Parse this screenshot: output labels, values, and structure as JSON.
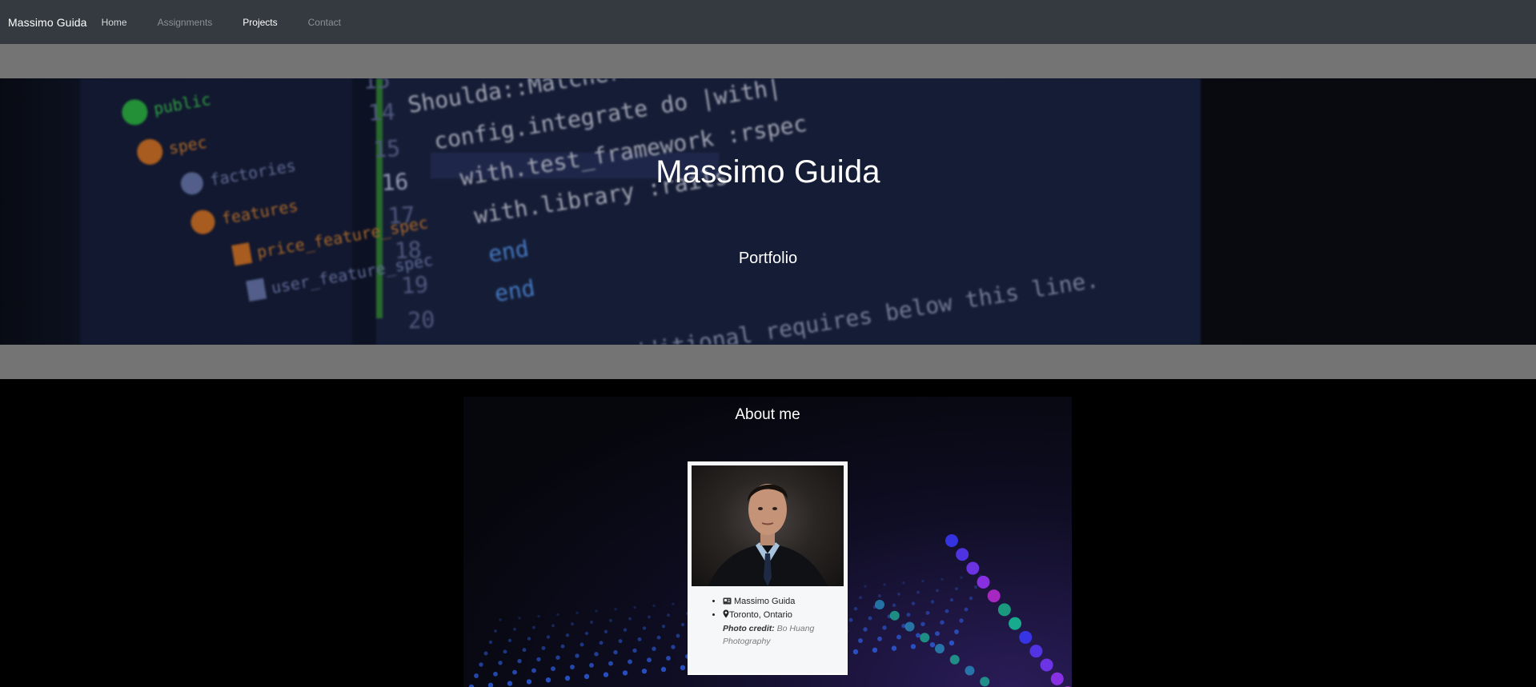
{
  "navbar": {
    "brand": "Massimo Guida",
    "links": [
      {
        "label": "Home"
      },
      {
        "label": "Assignments"
      },
      {
        "label": "Projects"
      },
      {
        "label": "Contact"
      }
    ]
  },
  "hero": {
    "title": "Massimo Guida",
    "subtitle": "Portfolio",
    "code_lines": [
      {
        "num": "15",
        "text": "Shoulda::Matchers.configure do |config|"
      },
      {
        "num": "14",
        "text": "  config.integrate do |with|"
      },
      {
        "num": "15",
        "text": "    with.test_framework :rspec"
      },
      {
        "num": "16",
        "text": "    with.library :rails"
      },
      {
        "num": "17",
        "text": "  end"
      },
      {
        "num": "18",
        "text": "end"
      },
      {
        "num": "19",
        "text": ""
      },
      {
        "num": "20",
        "text": "# Add additional requires below this line."
      }
    ],
    "file_tree": [
      "public",
      "spec",
      "factories",
      "features",
      "price_feature_spec",
      "user_feature_spec"
    ]
  },
  "about": {
    "title": "About me",
    "name": "Massimo Guida",
    "location": "Toronto, Ontario",
    "photo_credit_label": "Photo credit:",
    "photo_credit_value": "Bo Huang Photography"
  },
  "colors": {
    "navbar_bg": "#343a40",
    "band_grey": "#747474",
    "card_bg": "#f6f7f8"
  },
  "icons": {
    "name": "id-card-icon",
    "location": "map-marker-icon"
  }
}
